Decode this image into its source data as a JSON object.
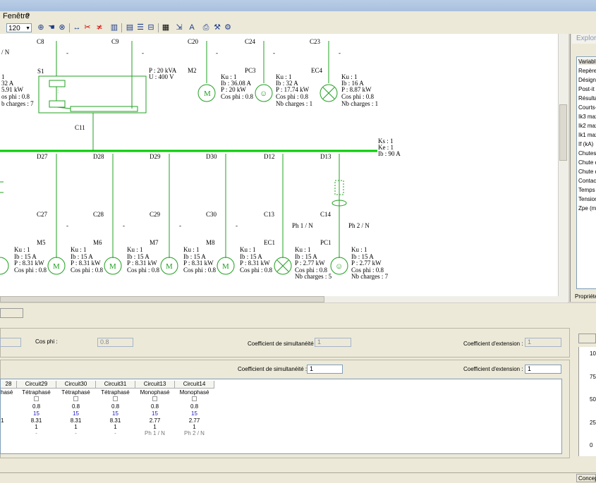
{
  "menu": {
    "window": "Fenêtre",
    "help": "?"
  },
  "toolbar": {
    "zoom_value": "120"
  },
  "colors": {
    "wire": "#20a020",
    "bus": "#00cc00",
    "text": "#000000"
  },
  "schematic": {
    "top_left_label": "/ N",
    "breakers_top": [
      "C8",
      "C9",
      "C20",
      "C24",
      "C23"
    ],
    "dashes": [
      "-",
      "-",
      "-",
      "-",
      "-"
    ],
    "S1": {
      "id": "S1",
      "p": "P : 20 kVA",
      "u": "U : 400 V"
    },
    "left_partial": [
      "1",
      "32 A",
      "5.91 kW",
      "os phi : 0.8",
      "b charges : 7"
    ],
    "M2": {
      "id": "M2",
      "ku": "Ku : 1",
      "ib": "Ib : 36.08 A",
      "p": "P : 20 kW",
      "cos": "Cos phi : 0.8"
    },
    "PC3": {
      "id": "PC3",
      "ku": "Ku : 1",
      "ib": "Ib : 32 A",
      "p": "P : 17.74 kW",
      "cos": "Cos phi : 0.8",
      "nb": "Nb charges : 1"
    },
    "EC4": {
      "id": "EC4",
      "ku": "Ku : 1",
      "ib": "Ib : 16 A",
      "p": "P : 8.87 kW",
      "cos": "Cos phi : 0.8",
      "nb": "Nb charges : 1"
    },
    "C11": "C11",
    "bus": {
      "ks": "Ks : 1",
      "ke": "Ke : 1",
      "ib": "Ib : 90 A"
    },
    "feeders": [
      "D27",
      "D28",
      "D29",
      "D30",
      "D12",
      "D13"
    ],
    "breakers_bottom": [
      "C27",
      "C28",
      "C29",
      "C30",
      "C13",
      "C14"
    ],
    "phase_labels": [
      "Ph 1 / N",
      "Ph 2 / N"
    ],
    "loads": [
      {
        "id": "M5",
        "ku": "Ku : 1",
        "ib": "Ib : 15 A",
        "p": "P : 8.31 kW",
        "cos": "Cos phi : 0.8"
      },
      {
        "id": "M6",
        "ku": "Ku : 1",
        "ib": "Ib : 15 A",
        "p": "P : 8.31 kW",
        "cos": "Cos phi : 0.8"
      },
      {
        "id": "M7",
        "ku": "Ku : 1",
        "ib": "Ib : 15 A",
        "p": "P : 8.31 kW",
        "cos": "Cos phi : 0.8"
      },
      {
        "id": "M8",
        "ku": "Ku : 1",
        "ib": "Ib : 15 A",
        "p": "P : 8.31 kW",
        "cos": "Cos phi : 0.8"
      },
      {
        "id": "EC1",
        "ku": "Ku : 1",
        "ib": "Ib : 15 A",
        "p": "P : 2.77 kW",
        "cos": "Cos phi : 0.8",
        "nb": "Nb charges : 5"
      },
      {
        "id": "PC1",
        "ku": "Ku : 1",
        "ib": "Ib : 15 A",
        "p": "P : 2.77 kW",
        "cos": "Cos phi : 0.8",
        "nb": "Nb charges : 7"
      }
    ],
    "first_load_partial": {
      "ku": "Ku : 1",
      "ib": "Ib : 15 A",
      "p": "P : 8.31 kW",
      "cos": "Cos phi : 0.8"
    }
  },
  "explorer": {
    "title": "Explora",
    "header": "Variabl",
    "rows": [
      "Repère",
      "Désigna",
      "Post-it",
      "Résulta",
      "Courts-",
      "Ik3 max",
      "Ik2 max",
      "Ik1 max",
      "If (kA)",
      "Chutes",
      "Chute d",
      "Chute d",
      "Contact",
      "Temps",
      "Tension",
      "Zpe (m"
    ],
    "tab": "Propriété"
  },
  "form": {
    "cos_phi_label": "Cos phi :",
    "cos_phi_value": "0.8",
    "simult_label_1": "Coefficient de simultanéité :",
    "simult_value_1": "1",
    "ext_label_1": "Coefficient d'extension :",
    "ext_value_1": "1",
    "simult_label_2": "Coefficient de simultanéité :",
    "simult_value_2": "1",
    "ext_label_2": "Coefficient d'extension :",
    "ext_value_2": "1"
  },
  "table": {
    "columns": [
      {
        "name": "28",
        "type": "hasé",
        "cos": "",
        "ib": "",
        "p": "1",
        "n": "",
        "ph": ""
      },
      {
        "name": "Circuit29",
        "type": "Tétraphasé",
        "cos": "0.8",
        "ib": "15",
        "p": "8.31",
        "n": "1",
        "ph": "-"
      },
      {
        "name": "Circuit30",
        "type": "Tétraphasé",
        "cos": "0.8",
        "ib": "15",
        "p": "8.31",
        "n": "1",
        "ph": "-"
      },
      {
        "name": "Circuit31",
        "type": "Tétraphasé",
        "cos": "0.8",
        "ib": "15",
        "p": "8.31",
        "n": "1",
        "ph": "-"
      },
      {
        "name": "Circuit13",
        "type": "Monophasé",
        "cos": "0.8",
        "ib": "15",
        "p": "2.77",
        "n": "1",
        "ph": "Ph 1 / N"
      },
      {
        "name": "Circuit14",
        "type": "Monophasé",
        "cos": "0.8",
        "ib": "15",
        "p": "2.77",
        "n": "1",
        "ph": "Ph 2 / N"
      }
    ]
  },
  "gauge": {
    "ticks": [
      "100",
      "75",
      "50",
      "25",
      "0"
    ]
  },
  "status": {
    "mode": "Concep"
  }
}
